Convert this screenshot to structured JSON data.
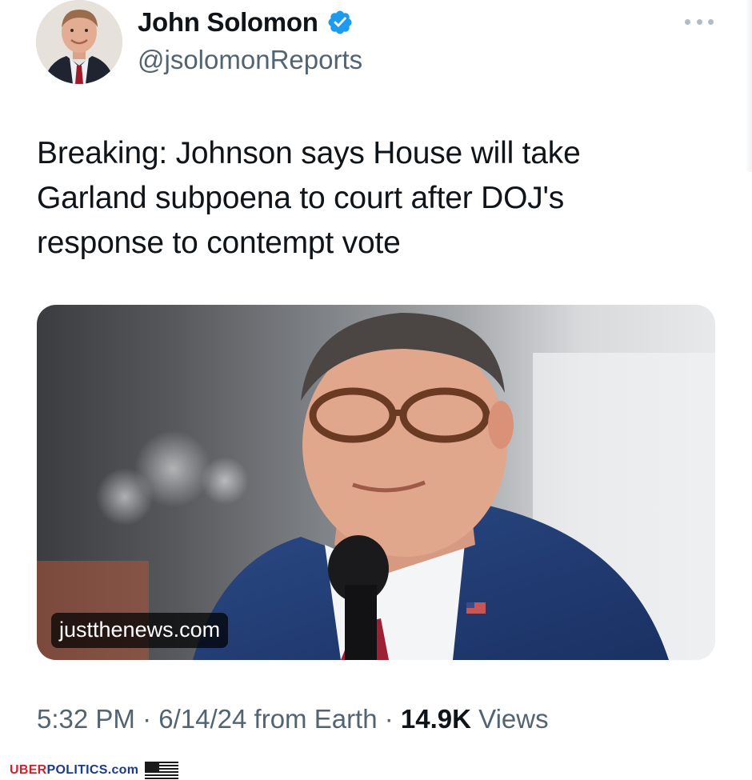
{
  "author": {
    "display_name": "John Solomon",
    "handle": "@jsolomonReports",
    "verified": true
  },
  "tweet": {
    "text": "Breaking: Johnson says House will take Garland subpoena to court after DOJ's response to contempt vote"
  },
  "media": {
    "source_label": "justthenews.com"
  },
  "meta": {
    "time": "5:32 PM",
    "sep1": "·",
    "date": "6/14/24",
    "origin": "from Earth",
    "sep2": "·",
    "views_count": "14.9K",
    "views_label": "Views"
  },
  "watermark": {
    "part1": "UBER",
    "part2": "POLITICS",
    "part3": ".com"
  },
  "colors": {
    "verified_blue": "#1d9bf0",
    "secondary_text": "#536471",
    "primary_text": "#0f1419",
    "watermark_red": "#d4202c",
    "watermark_blue": "#1a3a8f"
  },
  "icons": [
    "verified-badge-icon",
    "more-options-icon",
    "flag-icon"
  ]
}
